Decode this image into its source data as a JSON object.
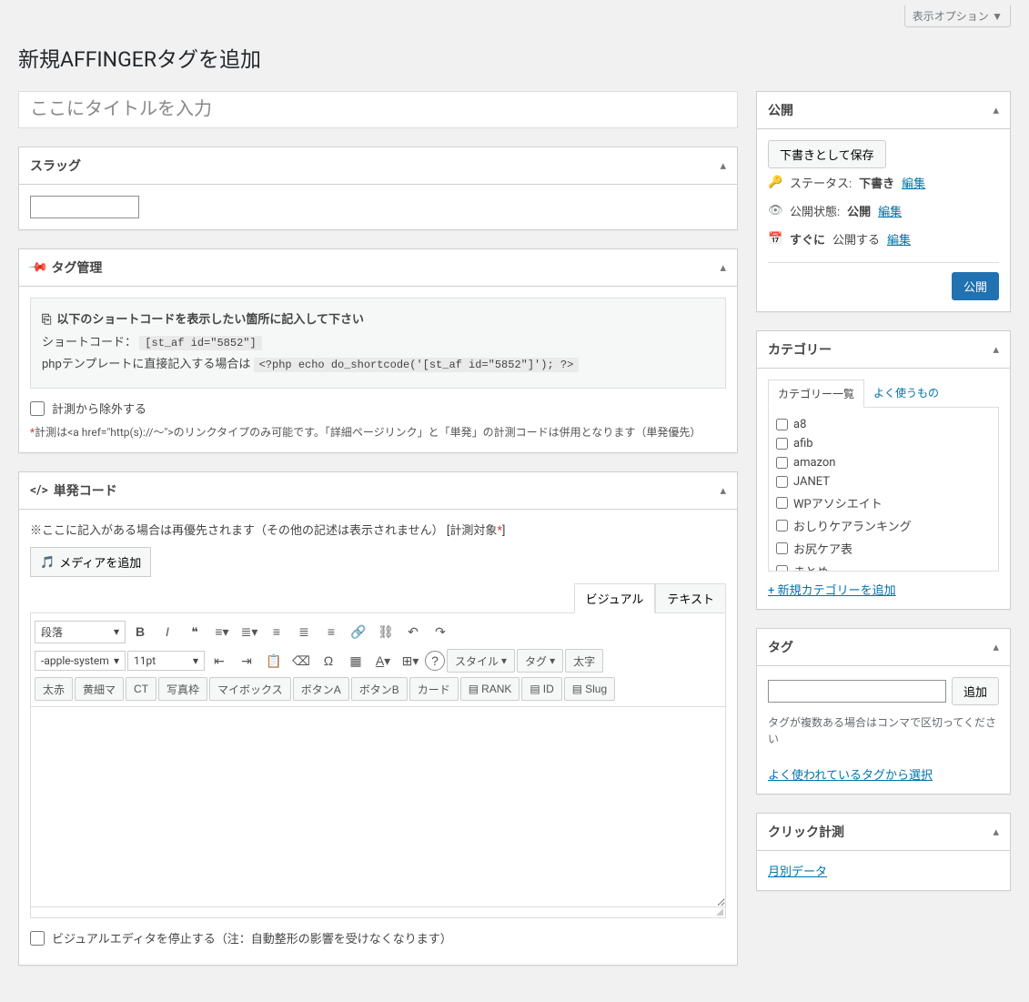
{
  "screen_options": "表示オプション ▼",
  "page_title": "新規AFFINGERタグを追加",
  "title_placeholder": "ここにタイトルを入力",
  "slug": {
    "heading": "スラッグ"
  },
  "tag_mgmt": {
    "heading": "タグ管理",
    "note_title": "以下のショートコードを表示したい箇所に記入して下さい",
    "shortcode_label": "ショートコード：",
    "shortcode": "[st_af id=\"5852\"]",
    "php_label": "phpテンプレートに直接記入する場合は",
    "php_code": "<?php echo do_shortcode('[st_af id=\"5852\"]'); ?>",
    "exclude_label": "計測から除外する",
    "warning": "計測は<a href=\"http(s)://〜\">のリンクタイプのみ可能です。「詳細ページリンク」と「単発」の計測コードは併用となります（単発優先）"
  },
  "single": {
    "heading": "単発コード",
    "note": "※ここに記入がある場合は再優先されます（その他の記述は表示されません）",
    "note_red": "[計測対象*]",
    "media_btn": "メディアを追加",
    "tab_visual": "ビジュアル",
    "tab_text": "テキスト",
    "sel_format": "段落",
    "sel_font": "-apple-system",
    "sel_size": "11pt",
    "style_btn": "スタイル",
    "tag_btn": "タグ",
    "bold_btn": "太字",
    "custom_btns": [
      "太赤",
      "黄細マ",
      "CT",
      "写真枠",
      "マイボックス",
      "ボタンA",
      "ボタンB",
      "カード",
      "RANK",
      "ID",
      "Slug"
    ],
    "stop_visual": "ビジュアルエディタを停止する（注：自動整形の影響を受けなくなります）"
  },
  "publish": {
    "heading": "公開",
    "save_draft": "下書きとして保存",
    "status_label": "ステータス:",
    "status_val": "下書き",
    "vis_label": "公開状態:",
    "vis_val": "公開",
    "sched_pre": "すぐに",
    "sched_post": "公開する",
    "edit": "編集",
    "publish_btn": "公開"
  },
  "categories": {
    "heading": "カテゴリー",
    "tab_all": "カテゴリー一覧",
    "tab_freq": "よく使うもの",
    "items": [
      "a8",
      "afib",
      "amazon",
      "JANET",
      "WPアソシエイト",
      "おしりケアランキング",
      "お尻ケア表",
      "まとめ"
    ],
    "add_new": "+ 新規カテゴリーを追加"
  },
  "tags": {
    "heading": "タグ",
    "add_btn": "追加",
    "note": "タグが複数ある場合はコンマで区切ってください",
    "choose": "よく使われているタグから選択"
  },
  "click": {
    "heading": "クリック計測",
    "link": "月別データ"
  }
}
